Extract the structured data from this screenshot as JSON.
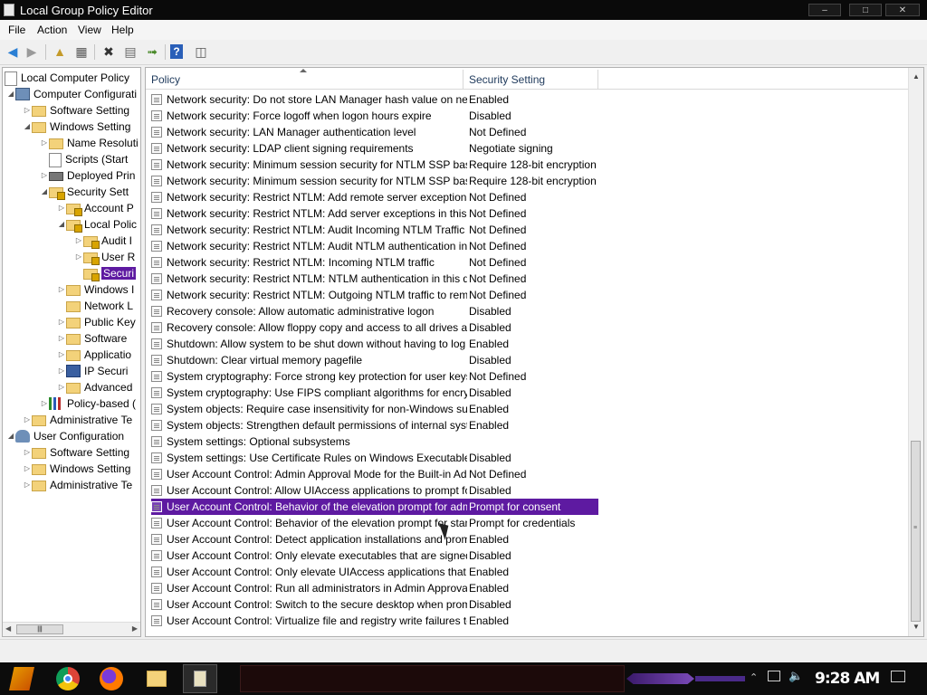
{
  "window": {
    "title": "Local Group Policy Editor",
    "min": "–",
    "max": "□",
    "close": "✕"
  },
  "menu": [
    "File",
    "Action",
    "View",
    "Help"
  ],
  "toolbar": {
    "icons": [
      "back-icon",
      "forward-icon",
      "up-folder-icon",
      "show-hide-tree-icon",
      "delete-icon",
      "properties-icon",
      "export-list-icon",
      "help-icon",
      "show-console-icon"
    ]
  },
  "tree": {
    "items": [
      {
        "label": "Local Computer Policy",
        "icon": "policy-doc-icon"
      },
      {
        "label": "Computer Configurati",
        "icon": "computer-icon"
      },
      {
        "label": "Software Setting",
        "icon": "folder-icon"
      },
      {
        "label": "Windows Setting",
        "icon": "folder-icon"
      },
      {
        "label": "Name Resoluti",
        "icon": "folder-icon"
      },
      {
        "label": "Scripts (Start",
        "icon": "script-icon"
      },
      {
        "label": "Deployed Prin",
        "icon": "printer-icon"
      },
      {
        "label": "Security Sett",
        "icon": "security-folder-icon"
      },
      {
        "label": "Account P",
        "icon": "security-folder-icon"
      },
      {
        "label": "Local Polic",
        "icon": "security-folder-icon"
      },
      {
        "label": "Audit I",
        "icon": "security-folder-icon"
      },
      {
        "label": "User R",
        "icon": "security-folder-icon"
      },
      {
        "label": "Securi",
        "icon": "security-folder-icon"
      },
      {
        "label": "Windows I",
        "icon": "folder-icon"
      },
      {
        "label": "Network L",
        "icon": "folder-icon"
      },
      {
        "label": "Public Key",
        "icon": "folder-icon"
      },
      {
        "label": "Software",
        "icon": "folder-icon"
      },
      {
        "label": "Applicatio",
        "icon": "folder-icon"
      },
      {
        "label": "IP Securi",
        "icon": "ip-security-icon"
      },
      {
        "label": "Advanced",
        "icon": "folder-icon"
      },
      {
        "label": "Policy-based (",
        "icon": "chart-icon"
      },
      {
        "label": "Administrative Te",
        "icon": "folder-icon"
      },
      {
        "label": "User Configuration",
        "icon": "user-icon"
      },
      {
        "label": "Software Setting",
        "icon": "folder-icon"
      },
      {
        "label": "Windows Setting",
        "icon": "folder-icon"
      },
      {
        "label": "Administrative Te",
        "icon": "folder-icon"
      }
    ]
  },
  "list": {
    "columns": [
      "Policy",
      "Security Setting"
    ],
    "rows": [
      {
        "policy": "Network security: Do not store LAN Manager hash value on next ...",
        "setting": "Enabled"
      },
      {
        "policy": "Network security: Force logoff when logon hours expire",
        "setting": "Disabled"
      },
      {
        "policy": "Network security: LAN Manager authentication level",
        "setting": "Not Defined"
      },
      {
        "policy": "Network security: LDAP client signing requirements",
        "setting": "Negotiate signing"
      },
      {
        "policy": "Network security: Minimum session security for NTLM SSP based (i...",
        "setting": "Require 128-bit encryption"
      },
      {
        "policy": "Network security: Minimum session security for NTLM SSP based (i...",
        "setting": "Require 128-bit encryption"
      },
      {
        "policy": "Network security: Restrict NTLM: Add remote server exceptions fo...",
        "setting": "Not Defined"
      },
      {
        "policy": "Network security: Restrict NTLM: Add server exceptions in this do...",
        "setting": "Not Defined"
      },
      {
        "policy": "Network security: Restrict NTLM: Audit Incoming NTLM Traffic",
        "setting": "Not Defined"
      },
      {
        "policy": "Network security: Restrict NTLM: Audit NTLM authentication in this ...",
        "setting": "Not Defined"
      },
      {
        "policy": "Network security: Restrict NTLM: Incoming NTLM traffic",
        "setting": "Not Defined"
      },
      {
        "policy": "Network security: Restrict NTLM: NTLM authentication in this domain",
        "setting": "Not Defined"
      },
      {
        "policy": "Network security: Restrict NTLM: Outgoing NTLM traffic to remote s...",
        "setting": "Not Defined"
      },
      {
        "policy": "Recovery console: Allow automatic administrative logon",
        "setting": "Disabled"
      },
      {
        "policy": "Recovery console: Allow floppy copy and access to all drives and ...",
        "setting": "Disabled"
      },
      {
        "policy": "Shutdown: Allow system to be shut down without having to log on",
        "setting": "Enabled"
      },
      {
        "policy": "Shutdown: Clear virtual memory pagefile",
        "setting": "Disabled"
      },
      {
        "policy": "System cryptography: Force strong key protection for user keys s...",
        "setting": "Not Defined"
      },
      {
        "policy": "System cryptography: Use FIPS compliant algorithms for encryptio...",
        "setting": "Disabled"
      },
      {
        "policy": "System objects: Require case insensitivity for non-Windows subsy...",
        "setting": "Enabled"
      },
      {
        "policy": "System objects: Strengthen default permissions of internal system ...",
        "setting": "Enabled"
      },
      {
        "policy": "System settings: Optional subsystems",
        "setting": ""
      },
      {
        "policy": "System settings: Use Certificate Rules on Windows Executables for ...",
        "setting": "Disabled"
      },
      {
        "policy": "User Account Control: Admin Approval Mode for the Built-in Admini...",
        "setting": "Not Defined"
      },
      {
        "policy": "User Account Control: Allow UIAccess applications to prompt for el...",
        "setting": "Disabled"
      },
      {
        "policy": "User Account Control: Behavior of the elevation prompt for admini...",
        "setting": "Prompt for consent"
      },
      {
        "policy": "User Account Control: Behavior of the elevation prompt for standa...",
        "setting": "Prompt for credentials"
      },
      {
        "policy": "User Account Control: Detect application installations and prompt ...",
        "setting": "Enabled"
      },
      {
        "policy": "User Account Control: Only elevate executables that are signed an...",
        "setting": "Disabled"
      },
      {
        "policy": "User Account Control: Only elevate UIAccess applications that are ...",
        "setting": "Enabled"
      },
      {
        "policy": "User Account Control: Run all administrators in Admin Approval Mode",
        "setting": "Enabled"
      },
      {
        "policy": "User Account Control: Switch to the secure desktop when prompti...",
        "setting": "Disabled"
      },
      {
        "policy": "User Account Control: Virtualize file and registry write failures to pe...",
        "setting": "Enabled"
      }
    ]
  },
  "taskbar": {
    "apps": [
      "start-icon",
      "chrome-icon",
      "firefox-icon",
      "file-explorer-icon",
      "group-policy-taskbar-icon"
    ],
    "tray": [
      "show-hidden-icons",
      "network-icon",
      "volume-icon"
    ],
    "clock": "9:28 AM",
    "accent": "#5e1aa1"
  },
  "colors": {
    "selection": "#5e1aa1",
    "folder": "#f3d27a"
  }
}
